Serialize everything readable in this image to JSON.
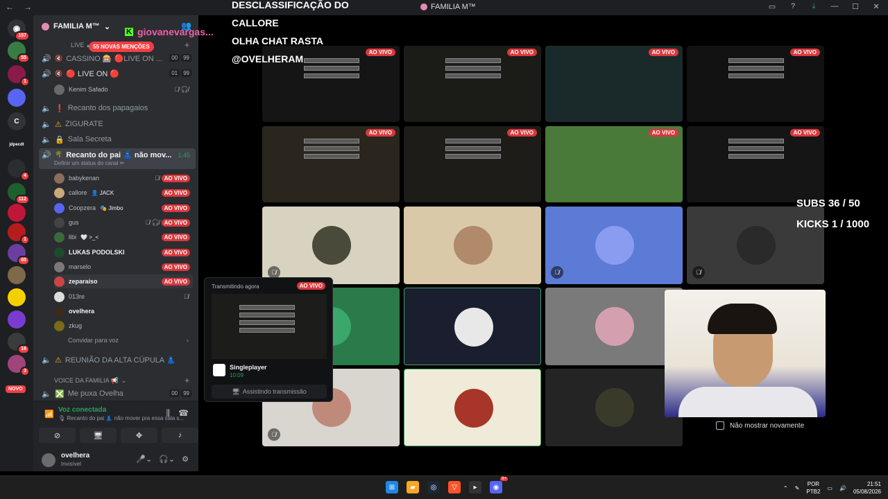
{
  "window": {
    "title": "FAMILIA M™",
    "back": "←",
    "forward": "→"
  },
  "rail": {
    "home_badge": "157",
    "servers": [
      {
        "label": "",
        "badge": "55",
        "color": "#3a7d44"
      },
      {
        "label": "",
        "badge": "1",
        "color": "#8b1a4a"
      },
      {
        "label": "",
        "badge": "",
        "color": "#5865f2"
      },
      {
        "label": "C",
        "badge": "",
        "color": "#313338"
      },
      {
        "label": "jdpecdt",
        "badge": "",
        "color": "#1e1f22"
      },
      {
        "label": "",
        "badge": "4",
        "color": "#2b2d31"
      },
      {
        "label": "",
        "badge": "112",
        "color": "#1f5f2f"
      },
      {
        "label": "",
        "badge": "",
        "color": "#c0163a"
      },
      {
        "label": "",
        "badge": "1",
        "color": "#b71c1c"
      },
      {
        "label": "",
        "badge": "65",
        "color": "#6a3fa0"
      },
      {
        "label": "",
        "badge": "",
        "color": "#7c6a4a"
      },
      {
        "label": "",
        "badge": "",
        "color": "#f5d000"
      },
      {
        "label": "",
        "badge": "",
        "color": "#7a3bd1"
      },
      {
        "label": "",
        "badge": "16",
        "color": "#3b3b3b"
      },
      {
        "label": "",
        "badge": "3",
        "color": "#a0447a"
      }
    ],
    "novo": "NOVO"
  },
  "sidebar": {
    "server_name": "FAMILIA M™",
    "category_live": "LIVE",
    "mentions": "55 NOVAS MENÇÕES",
    "channels": {
      "cassino": {
        "name": "CASSINO 🎰 🔴LIVE ON ...",
        "count_a": "00",
        "count_b": "99"
      },
      "live_on": {
        "name": "🔴 LIVE ON 🔴",
        "count_a": "01",
        "count_b": "99"
      },
      "kenim": "Kenim Safado",
      "recanto_papagaios": "Recanto dos papagaios",
      "zigurate": "ZIGURATE",
      "sala_secreta": "Sala Secreta",
      "recanto_pai": "Recanto do pai 👗 não mov...",
      "recanto_pai_timer": "1:45",
      "recanto_pai_status": "Definir um status do canal ✏",
      "reuniao": "REUNIÃO DA ALTA CÚPULA 👗",
      "category_voice": "VOICE DA FAMILIA 📢",
      "me_puxa": "Me puxa Ovelha",
      "me_puxa_a": "00",
      "me_puxa_b": "99"
    },
    "users": [
      {
        "name": "babykenan",
        "tag": "",
        "bold": false,
        "icons": "🎙̸",
        "live": "AO VIVO",
        "color": "#8a6d5a"
      },
      {
        "name": "callore",
        "tag": "👤 JACK",
        "bold": false,
        "icons": "",
        "live": "AO VIVO",
        "color": "#c9a97a"
      },
      {
        "name": "Coopzera",
        "tag": "🎭 Jimbo",
        "bold": false,
        "icons": "",
        "live": "AO VIVO",
        "color": "#5865f2"
      },
      {
        "name": "gus",
        "tag": "",
        "bold": false,
        "icons": "🎙̸ 🎧̸",
        "live": "AO VIVO",
        "color": "#444"
      },
      {
        "name": "libi",
        "tag": "🤍 >_<",
        "bold": false,
        "icons": "",
        "live": "AO VIVO",
        "color": "#3a6b3a"
      },
      {
        "name": "LUKAS PODOLSKI",
        "tag": "",
        "bold": true,
        "icons": "",
        "live": "AO VIVO",
        "color": "#1d4a2d"
      },
      {
        "name": "marselo",
        "tag": "",
        "bold": false,
        "icons": "",
        "live": "AO VIVO",
        "color": "#7a7a7a"
      },
      {
        "name": "zeparaiso",
        "tag": "",
        "bold": true,
        "icons": "",
        "live": "AO VIVO",
        "color": "#c44"
      },
      {
        "name": "013re",
        "tag": "",
        "bold": false,
        "icons": "🎙̸",
        "live": "",
        "color": "#ddd"
      },
      {
        "name": "ovelhera",
        "tag": "",
        "bold": true,
        "icons": "",
        "live": "",
        "color": "#3c2a1a"
      },
      {
        "name": "zkug",
        "tag": "",
        "bold": false,
        "icons": "",
        "live": "",
        "color": "#7a6a1a"
      }
    ],
    "invite": "Convidar para voz"
  },
  "voice": {
    "title": "Voz conectada",
    "subtitle": "🎙 Recanto do pai 👗 não mover pra essa sala s..."
  },
  "user_panel": {
    "name": "ovelhera",
    "status": "Invisível"
  },
  "overlay": {
    "line1": "DESCLASSIFICAÇÃO DO",
    "line2": "CALLORE",
    "line3": "OLHA CHAT RASTA",
    "line4": "@OVELHERAM",
    "kick_user": "giovanevargas...",
    "subs": "SUBS 36 / 50",
    "kicks": "KICKS 1 / 1000"
  },
  "stream_live": "AO VIVO",
  "popup": {
    "header": "Transmitindo agora",
    "live": "AO VIVO",
    "game": "Singleplayer",
    "time": "10:09",
    "watch": "Assistindo transmissão"
  },
  "dont_show": "Não mostrar novamente",
  "taskbar": {
    "lang1": "POR",
    "lang2": "PTB2",
    "time": "21:51",
    "date": "05/08/2026",
    "discord_badge": "9+"
  }
}
